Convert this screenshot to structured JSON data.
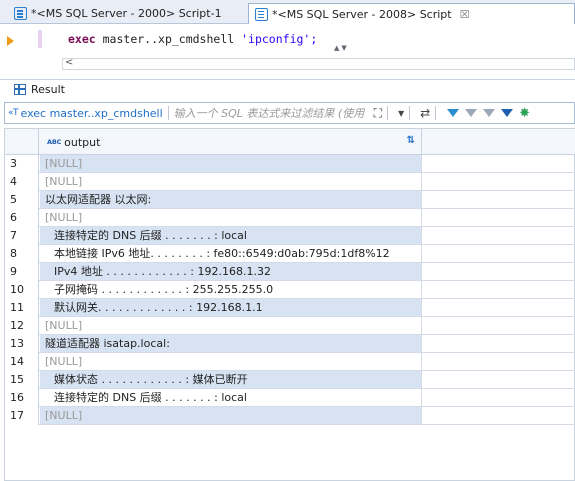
{
  "tabs": [
    {
      "label": "*<MS SQL Server - 2000> Script-1",
      "active": false
    },
    {
      "label": "*<MS SQL Server - 2008> Script",
      "active": true,
      "close": "☒"
    }
  ],
  "editor": {
    "code_kw": "exec",
    "code_plain": " master..xp_cmdshell ",
    "code_str": "'ipconfig';",
    "hscroll_left": "<"
  },
  "result": {
    "title": "Result",
    "query_text": "exec master..xp_cmdshell",
    "filter_placeholder": "输入一个 SQL 表达式来过滤结果 (使用",
    "column": "output",
    "column_type_badge": "ABC",
    "rows": [
      {
        "num": "3",
        "text": "[NULL]",
        "null": true
      },
      {
        "num": "4",
        "text": "[NULL]",
        "null": true
      },
      {
        "num": "5",
        "text": "以太网适配器 以太网:",
        "null": false
      },
      {
        "num": "6",
        "text": "[NULL]",
        "null": true
      },
      {
        "num": "7",
        "text": "连接特定的 DNS 后缀 . . . . . . . : local",
        "null": false,
        "indent": true
      },
      {
        "num": "8",
        "text": "本地链接 IPv6 地址. . . . . . . . : fe80::6549:d0ab:795d:1df8%12",
        "null": false,
        "indent": true
      },
      {
        "num": "9",
        "text": "IPv4 地址 . . . . . . . . . . . . : 192.168.1.32",
        "null": false,
        "indent": true
      },
      {
        "num": "10",
        "text": "子网掩码 . . . . . . . . . . . . : 255.255.255.0",
        "null": false,
        "indent": true
      },
      {
        "num": "11",
        "text": "默认网关. . . . . . . . . . . . . : 192.168.1.1",
        "null": false,
        "indent": true
      },
      {
        "num": "12",
        "text": "[NULL]",
        "null": true
      },
      {
        "num": "13",
        "text": "隧道适配器 isatap.local:",
        "null": false
      },
      {
        "num": "14",
        "text": "[NULL]",
        "null": true
      },
      {
        "num": "15",
        "text": "媒体状态 . . . . . . . . . . . . : 媒体已断开",
        "null": false,
        "indent": true
      },
      {
        "num": "16",
        "text": "连接特定的 DNS 后缀 . . . . . . . : local",
        "null": false,
        "indent": true
      },
      {
        "num": "17",
        "text": "[NULL]",
        "null": true
      }
    ]
  },
  "colors": {
    "accent": "#1f6fc5",
    "row_alt": "#d7e3f2",
    "keyword": "#7a0b55",
    "string": "#2a00ff"
  }
}
